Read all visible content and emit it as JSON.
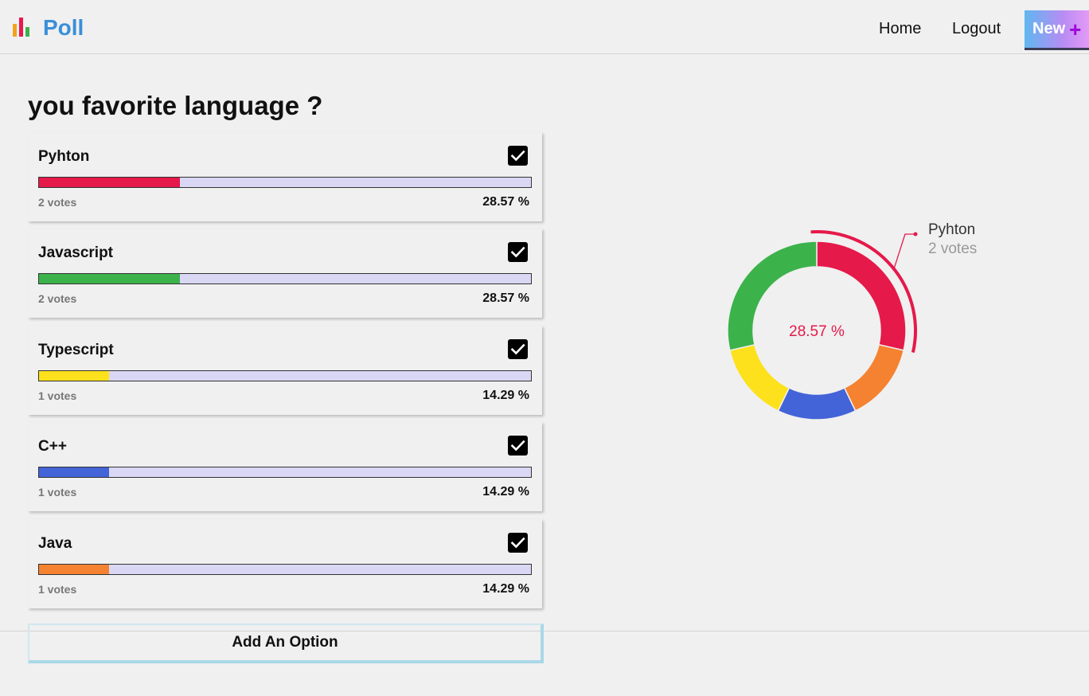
{
  "header": {
    "logo_text": "Poll",
    "logo_colors": [
      "#f2a31b",
      "#e8184f",
      "#3cb24b"
    ],
    "nav": {
      "home": "Home",
      "logout": "Logout"
    },
    "new_button": {
      "label": "New",
      "icon": "plus-icon"
    }
  },
  "poll": {
    "title": "you favorite language ?",
    "options": [
      {
        "label": "Pyhton",
        "votes_text": "2 votes",
        "percent_text": "28.57 %",
        "percent": 28.57,
        "color": "#e5194a",
        "checked": true
      },
      {
        "label": "Javascript",
        "votes_text": "2 votes",
        "percent_text": "28.57 %",
        "percent": 28.57,
        "color": "#3cb24b",
        "checked": true
      },
      {
        "label": "Typescript",
        "votes_text": "1 votes",
        "percent_text": "14.29 %",
        "percent": 14.29,
        "color": "#fde11c",
        "checked": true
      },
      {
        "label": "C++",
        "votes_text": "1 votes",
        "percent_text": "14.29 %",
        "percent": 14.29,
        "color": "#4363d8",
        "checked": true
      },
      {
        "label": "Java",
        "votes_text": "1 votes",
        "percent_text": "14.29 %",
        "percent": 14.29,
        "color": "#f58230",
        "checked": true
      }
    ],
    "add_option_label": "Add An Option"
  },
  "chart_data": {
    "type": "pie",
    "categories": [
      "Pyhton",
      "Java",
      "C++",
      "Typescript",
      "Javascript"
    ],
    "values": [
      2,
      1,
      1,
      1,
      2
    ],
    "colors": [
      "#e5194a",
      "#f58230",
      "#4363d8",
      "#fde11c",
      "#3cb24b"
    ],
    "center_label": "28.57 %",
    "hover": {
      "label": "Pyhton",
      "value_text": "2 votes"
    }
  }
}
